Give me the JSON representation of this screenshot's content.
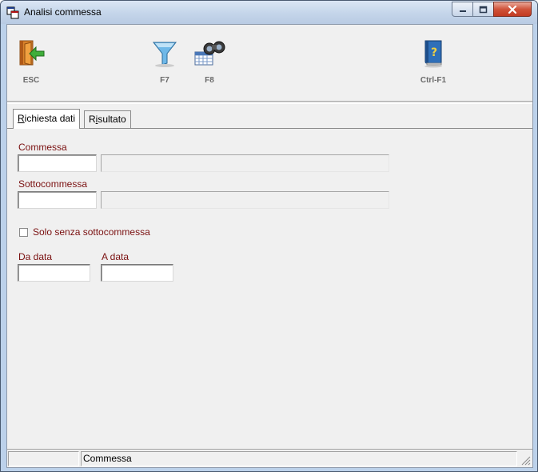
{
  "window": {
    "title": "Analisi commessa"
  },
  "toolbar": {
    "items": [
      {
        "key": "ESC",
        "icon": "exit-door-icon"
      },
      {
        "key": "F7",
        "icon": "filter-funnel-icon"
      },
      {
        "key": "F8",
        "icon": "binoculars-search-icon"
      },
      {
        "key": "Ctrl-F1",
        "icon": "help-book-icon"
      }
    ]
  },
  "tabs": [
    {
      "label_first": "R",
      "label_rest": "ichiesta dati",
      "active": true
    },
    {
      "label_first": "R",
      "label_mid_u": "i",
      "label_rest": "sultato",
      "active": false
    }
  ],
  "form": {
    "commessa_label": "Commessa",
    "commessa_value": "",
    "commessa_desc": "",
    "sottocommessa_label": "Sottocommessa",
    "sottocommessa_value": "",
    "sottocommessa_desc": "",
    "solo_senza_label": "Solo senza sottocommessa",
    "solo_senza_checked": false,
    "da_data_label": "Da data",
    "da_data_value": "",
    "a_data_label": "A data",
    "a_data_value": ""
  },
  "statusbar": {
    "pane1": "",
    "pane2": "Commessa"
  },
  "colors": {
    "label_text": "#7a1010",
    "title_bar": "#c4d5ea",
    "close_button": "#c23b22"
  }
}
